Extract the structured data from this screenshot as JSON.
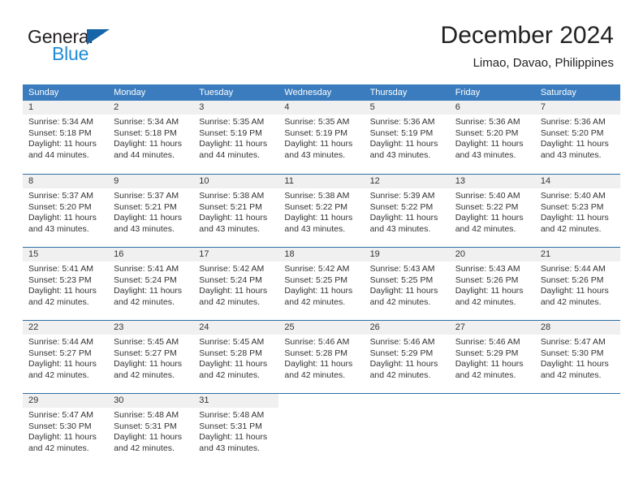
{
  "brand": {
    "name_part1": "General",
    "name_part2": "Blue",
    "triangle_color": "#1565a8",
    "blue_text_color": "#1f8bd6"
  },
  "header": {
    "title": "December 2024",
    "subtitle": "Limao, Davao, Philippines",
    "accent_color": "#3a7cbe",
    "rule_color": "#2e6da4",
    "daynum_band_color": "#f0f0f0"
  },
  "weekdays": [
    "Sunday",
    "Monday",
    "Tuesday",
    "Wednesday",
    "Thursday",
    "Friday",
    "Saturday"
  ],
  "weeks": [
    [
      {
        "day": "1",
        "sunrise": "Sunrise: 5:34 AM",
        "sunset": "Sunset: 5:18 PM",
        "daylight1": "Daylight: 11 hours",
        "daylight2": "and 44 minutes."
      },
      {
        "day": "2",
        "sunrise": "Sunrise: 5:34 AM",
        "sunset": "Sunset: 5:18 PM",
        "daylight1": "Daylight: 11 hours",
        "daylight2": "and 44 minutes."
      },
      {
        "day": "3",
        "sunrise": "Sunrise: 5:35 AM",
        "sunset": "Sunset: 5:19 PM",
        "daylight1": "Daylight: 11 hours",
        "daylight2": "and 44 minutes."
      },
      {
        "day": "4",
        "sunrise": "Sunrise: 5:35 AM",
        "sunset": "Sunset: 5:19 PM",
        "daylight1": "Daylight: 11 hours",
        "daylight2": "and 43 minutes."
      },
      {
        "day": "5",
        "sunrise": "Sunrise: 5:36 AM",
        "sunset": "Sunset: 5:19 PM",
        "daylight1": "Daylight: 11 hours",
        "daylight2": "and 43 minutes."
      },
      {
        "day": "6",
        "sunrise": "Sunrise: 5:36 AM",
        "sunset": "Sunset: 5:20 PM",
        "daylight1": "Daylight: 11 hours",
        "daylight2": "and 43 minutes."
      },
      {
        "day": "7",
        "sunrise": "Sunrise: 5:36 AM",
        "sunset": "Sunset: 5:20 PM",
        "daylight1": "Daylight: 11 hours",
        "daylight2": "and 43 minutes."
      }
    ],
    [
      {
        "day": "8",
        "sunrise": "Sunrise: 5:37 AM",
        "sunset": "Sunset: 5:20 PM",
        "daylight1": "Daylight: 11 hours",
        "daylight2": "and 43 minutes."
      },
      {
        "day": "9",
        "sunrise": "Sunrise: 5:37 AM",
        "sunset": "Sunset: 5:21 PM",
        "daylight1": "Daylight: 11 hours",
        "daylight2": "and 43 minutes."
      },
      {
        "day": "10",
        "sunrise": "Sunrise: 5:38 AM",
        "sunset": "Sunset: 5:21 PM",
        "daylight1": "Daylight: 11 hours",
        "daylight2": "and 43 minutes."
      },
      {
        "day": "11",
        "sunrise": "Sunrise: 5:38 AM",
        "sunset": "Sunset: 5:22 PM",
        "daylight1": "Daylight: 11 hours",
        "daylight2": "and 43 minutes."
      },
      {
        "day": "12",
        "sunrise": "Sunrise: 5:39 AM",
        "sunset": "Sunset: 5:22 PM",
        "daylight1": "Daylight: 11 hours",
        "daylight2": "and 43 minutes."
      },
      {
        "day": "13",
        "sunrise": "Sunrise: 5:40 AM",
        "sunset": "Sunset: 5:22 PM",
        "daylight1": "Daylight: 11 hours",
        "daylight2": "and 42 minutes."
      },
      {
        "day": "14",
        "sunrise": "Sunrise: 5:40 AM",
        "sunset": "Sunset: 5:23 PM",
        "daylight1": "Daylight: 11 hours",
        "daylight2": "and 42 minutes."
      }
    ],
    [
      {
        "day": "15",
        "sunrise": "Sunrise: 5:41 AM",
        "sunset": "Sunset: 5:23 PM",
        "daylight1": "Daylight: 11 hours",
        "daylight2": "and 42 minutes."
      },
      {
        "day": "16",
        "sunrise": "Sunrise: 5:41 AM",
        "sunset": "Sunset: 5:24 PM",
        "daylight1": "Daylight: 11 hours",
        "daylight2": "and 42 minutes."
      },
      {
        "day": "17",
        "sunrise": "Sunrise: 5:42 AM",
        "sunset": "Sunset: 5:24 PM",
        "daylight1": "Daylight: 11 hours",
        "daylight2": "and 42 minutes."
      },
      {
        "day": "18",
        "sunrise": "Sunrise: 5:42 AM",
        "sunset": "Sunset: 5:25 PM",
        "daylight1": "Daylight: 11 hours",
        "daylight2": "and 42 minutes."
      },
      {
        "day": "19",
        "sunrise": "Sunrise: 5:43 AM",
        "sunset": "Sunset: 5:25 PM",
        "daylight1": "Daylight: 11 hours",
        "daylight2": "and 42 minutes."
      },
      {
        "day": "20",
        "sunrise": "Sunrise: 5:43 AM",
        "sunset": "Sunset: 5:26 PM",
        "daylight1": "Daylight: 11 hours",
        "daylight2": "and 42 minutes."
      },
      {
        "day": "21",
        "sunrise": "Sunrise: 5:44 AM",
        "sunset": "Sunset: 5:26 PM",
        "daylight1": "Daylight: 11 hours",
        "daylight2": "and 42 minutes."
      }
    ],
    [
      {
        "day": "22",
        "sunrise": "Sunrise: 5:44 AM",
        "sunset": "Sunset: 5:27 PM",
        "daylight1": "Daylight: 11 hours",
        "daylight2": "and 42 minutes."
      },
      {
        "day": "23",
        "sunrise": "Sunrise: 5:45 AM",
        "sunset": "Sunset: 5:27 PM",
        "daylight1": "Daylight: 11 hours",
        "daylight2": "and 42 minutes."
      },
      {
        "day": "24",
        "sunrise": "Sunrise: 5:45 AM",
        "sunset": "Sunset: 5:28 PM",
        "daylight1": "Daylight: 11 hours",
        "daylight2": "and 42 minutes."
      },
      {
        "day": "25",
        "sunrise": "Sunrise: 5:46 AM",
        "sunset": "Sunset: 5:28 PM",
        "daylight1": "Daylight: 11 hours",
        "daylight2": "and 42 minutes."
      },
      {
        "day": "26",
        "sunrise": "Sunrise: 5:46 AM",
        "sunset": "Sunset: 5:29 PM",
        "daylight1": "Daylight: 11 hours",
        "daylight2": "and 42 minutes."
      },
      {
        "day": "27",
        "sunrise": "Sunrise: 5:46 AM",
        "sunset": "Sunset: 5:29 PM",
        "daylight1": "Daylight: 11 hours",
        "daylight2": "and 42 minutes."
      },
      {
        "day": "28",
        "sunrise": "Sunrise: 5:47 AM",
        "sunset": "Sunset: 5:30 PM",
        "daylight1": "Daylight: 11 hours",
        "daylight2": "and 42 minutes."
      }
    ],
    [
      {
        "day": "29",
        "sunrise": "Sunrise: 5:47 AM",
        "sunset": "Sunset: 5:30 PM",
        "daylight1": "Daylight: 11 hours",
        "daylight2": "and 42 minutes."
      },
      {
        "day": "30",
        "sunrise": "Sunrise: 5:48 AM",
        "sunset": "Sunset: 5:31 PM",
        "daylight1": "Daylight: 11 hours",
        "daylight2": "and 42 minutes."
      },
      {
        "day": "31",
        "sunrise": "Sunrise: 5:48 AM",
        "sunset": "Sunset: 5:31 PM",
        "daylight1": "Daylight: 11 hours",
        "daylight2": "and 43 minutes."
      },
      {
        "day": "",
        "sunrise": "",
        "sunset": "",
        "daylight1": "",
        "daylight2": ""
      },
      {
        "day": "",
        "sunrise": "",
        "sunset": "",
        "daylight1": "",
        "daylight2": ""
      },
      {
        "day": "",
        "sunrise": "",
        "sunset": "",
        "daylight1": "",
        "daylight2": ""
      },
      {
        "day": "",
        "sunrise": "",
        "sunset": "",
        "daylight1": "",
        "daylight2": ""
      }
    ]
  ]
}
